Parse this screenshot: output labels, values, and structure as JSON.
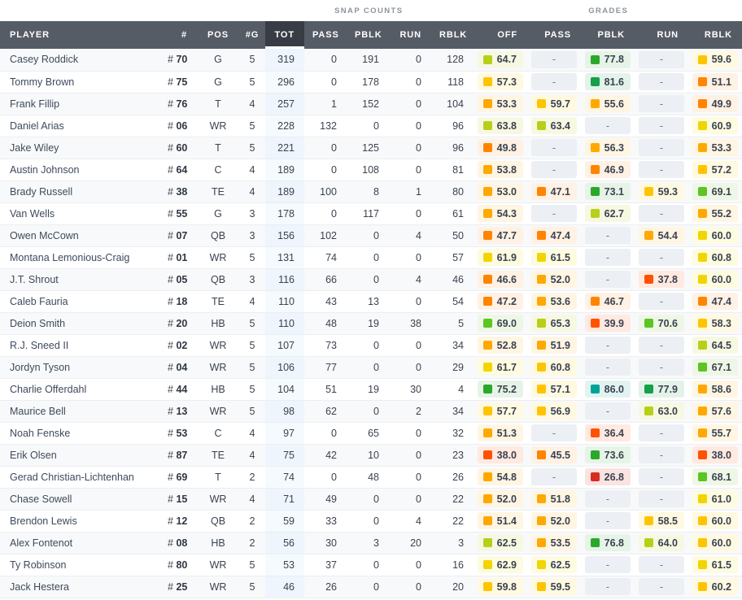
{
  "table": {
    "groups": [
      {
        "label": "",
        "span": 4,
        "kind": "gap"
      },
      {
        "label": "SNAP COUNTS",
        "span": 5,
        "kind": "snap"
      },
      {
        "label": "GRADES",
        "span": 5,
        "kind": "grades"
      }
    ],
    "columns": [
      {
        "key": "player",
        "label": "PLAYER",
        "align": "left"
      },
      {
        "key": "jersey",
        "label": "#",
        "align": "right"
      },
      {
        "key": "pos",
        "label": "POS",
        "align": "center"
      },
      {
        "key": "games",
        "label": "#G",
        "align": "center"
      },
      {
        "key": "snap_tot",
        "label": "TOT",
        "align": "right",
        "sorted": true
      },
      {
        "key": "snap_pass",
        "label": "PASS",
        "align": "right"
      },
      {
        "key": "snap_pblk",
        "label": "PBLK",
        "align": "right"
      },
      {
        "key": "snap_run",
        "label": "RUN",
        "align": "right"
      },
      {
        "key": "snap_rblk",
        "label": "RBLK",
        "align": "right"
      },
      {
        "key": "grade_off",
        "label": "OFF",
        "align": "right"
      },
      {
        "key": "grade_pass",
        "label": "PASS",
        "align": "right"
      },
      {
        "key": "grade_pblk",
        "label": "PBLK",
        "align": "right"
      },
      {
        "key": "grade_run",
        "label": "RUN",
        "align": "right"
      },
      {
        "key": "grade_rblk",
        "label": "RBLK",
        "align": "right"
      }
    ],
    "empty_value": "-",
    "grade_colors": {
      "teal": "#00a398",
      "dark_green": "#15a049",
      "green": "#2aa82a",
      "light_green": "#5cc423",
      "yellow_green": "#b8cf1a",
      "yellow": "#f2d500",
      "gold": "#ffc400",
      "amber": "#ffa800",
      "orange": "#ff8400",
      "deep_orange": "#ff5100",
      "red": "#d92b20"
    },
    "chip_backgrounds": {
      "teal": "#e2f4f2",
      "dark_green": "#e4f3e9",
      "green": "#e6f4e7",
      "light_green": "#eef7e5",
      "yellow_green": "#f6f8e2",
      "yellow": "#fdfbe0",
      "gold": "#fff9e2",
      "amber": "#fff5e3",
      "orange": "#fff1e3",
      "deep_orange": "#ffe9e0",
      "red": "#fae3e1"
    },
    "rows": [
      {
        "player": "Casey Roddick",
        "jersey": "70",
        "pos": "G",
        "games": "5",
        "snap_tot": "319",
        "snap_pass": "0",
        "snap_pblk": "191",
        "snap_run": "0",
        "snap_rblk": "128",
        "grade_off": {
          "v": "64.7",
          "c": "yellow_green"
        },
        "grade_pass": {
          "v": "-"
        },
        "grade_pblk": {
          "v": "77.8",
          "c": "green"
        },
        "grade_run": {
          "v": "-"
        },
        "grade_rblk": {
          "v": "59.6",
          "c": "gold"
        }
      },
      {
        "player": "Tommy Brown",
        "jersey": "75",
        "pos": "G",
        "games": "5",
        "snap_tot": "296",
        "snap_pass": "0",
        "snap_pblk": "178",
        "snap_run": "0",
        "snap_rblk": "118",
        "grade_off": {
          "v": "57.3",
          "c": "gold"
        },
        "grade_pass": {
          "v": "-"
        },
        "grade_pblk": {
          "v": "81.6",
          "c": "dark_green"
        },
        "grade_run": {
          "v": "-"
        },
        "grade_rblk": {
          "v": "51.1",
          "c": "orange"
        }
      },
      {
        "player": "Frank Fillip",
        "jersey": "76",
        "pos": "T",
        "games": "4",
        "snap_tot": "257",
        "snap_pass": "1",
        "snap_pblk": "152",
        "snap_run": "0",
        "snap_rblk": "104",
        "grade_off": {
          "v": "53.3",
          "c": "amber"
        },
        "grade_pass": {
          "v": "59.7",
          "c": "gold"
        },
        "grade_pblk": {
          "v": "55.6",
          "c": "amber"
        },
        "grade_run": {
          "v": "-"
        },
        "grade_rblk": {
          "v": "49.9",
          "c": "orange"
        }
      },
      {
        "player": "Daniel Arias",
        "jersey": "06",
        "pos": "WR",
        "games": "5",
        "snap_tot": "228",
        "snap_pass": "132",
        "snap_pblk": "0",
        "snap_run": "0",
        "snap_rblk": "96",
        "grade_off": {
          "v": "63.8",
          "c": "yellow_green"
        },
        "grade_pass": {
          "v": "63.4",
          "c": "yellow_green"
        },
        "grade_pblk": {
          "v": "-"
        },
        "grade_run": {
          "v": "-"
        },
        "grade_rblk": {
          "v": "60.9",
          "c": "yellow"
        }
      },
      {
        "player": "Jake Wiley",
        "jersey": "60",
        "pos": "T",
        "games": "5",
        "snap_tot": "221",
        "snap_pass": "0",
        "snap_pblk": "125",
        "snap_run": "0",
        "snap_rblk": "96",
        "grade_off": {
          "v": "49.8",
          "c": "orange"
        },
        "grade_pass": {
          "v": "-"
        },
        "grade_pblk": {
          "v": "56.3",
          "c": "amber"
        },
        "grade_run": {
          "v": "-"
        },
        "grade_rblk": {
          "v": "53.3",
          "c": "amber"
        }
      },
      {
        "player": "Austin Johnson",
        "jersey": "64",
        "pos": "C",
        "games": "4",
        "snap_tot": "189",
        "snap_pass": "0",
        "snap_pblk": "108",
        "snap_run": "0",
        "snap_rblk": "81",
        "grade_off": {
          "v": "53.8",
          "c": "amber"
        },
        "grade_pass": {
          "v": "-"
        },
        "grade_pblk": {
          "v": "46.9",
          "c": "orange"
        },
        "grade_run": {
          "v": "-"
        },
        "grade_rblk": {
          "v": "57.2",
          "c": "gold"
        }
      },
      {
        "player": "Brady Russell",
        "jersey": "38",
        "pos": "TE",
        "games": "4",
        "snap_tot": "189",
        "snap_pass": "100",
        "snap_pblk": "8",
        "snap_run": "1",
        "snap_rblk": "80",
        "grade_off": {
          "v": "53.0",
          "c": "amber"
        },
        "grade_pass": {
          "v": "47.1",
          "c": "orange"
        },
        "grade_pblk": {
          "v": "73.1",
          "c": "green"
        },
        "grade_run": {
          "v": "59.3",
          "c": "gold"
        },
        "grade_rblk": {
          "v": "69.1",
          "c": "light_green"
        }
      },
      {
        "player": "Van Wells",
        "jersey": "55",
        "pos": "G",
        "games": "3",
        "snap_tot": "178",
        "snap_pass": "0",
        "snap_pblk": "117",
        "snap_run": "0",
        "snap_rblk": "61",
        "grade_off": {
          "v": "54.3",
          "c": "amber"
        },
        "grade_pass": {
          "v": "-"
        },
        "grade_pblk": {
          "v": "62.7",
          "c": "yellow_green"
        },
        "grade_run": {
          "v": "-"
        },
        "grade_rblk": {
          "v": "55.2",
          "c": "amber"
        }
      },
      {
        "player": "Owen McCown",
        "jersey": "07",
        "pos": "QB",
        "games": "3",
        "snap_tot": "156",
        "snap_pass": "102",
        "snap_pblk": "0",
        "snap_run": "4",
        "snap_rblk": "50",
        "grade_off": {
          "v": "47.7",
          "c": "orange"
        },
        "grade_pass": {
          "v": "47.4",
          "c": "orange"
        },
        "grade_pblk": {
          "v": "-"
        },
        "grade_run": {
          "v": "54.4",
          "c": "amber"
        },
        "grade_rblk": {
          "v": "60.0",
          "c": "yellow"
        }
      },
      {
        "player": "Montana Lemonious-Craig",
        "jersey": "01",
        "pos": "WR",
        "games": "5",
        "snap_tot": "131",
        "snap_pass": "74",
        "snap_pblk": "0",
        "snap_run": "0",
        "snap_rblk": "57",
        "grade_off": {
          "v": "61.9",
          "c": "yellow"
        },
        "grade_pass": {
          "v": "61.5",
          "c": "yellow"
        },
        "grade_pblk": {
          "v": "-"
        },
        "grade_run": {
          "v": "-"
        },
        "grade_rblk": {
          "v": "60.8",
          "c": "yellow"
        }
      },
      {
        "player": "J.T. Shrout",
        "jersey": "05",
        "pos": "QB",
        "games": "3",
        "snap_tot": "116",
        "snap_pass": "66",
        "snap_pblk": "0",
        "snap_run": "4",
        "snap_rblk": "46",
        "grade_off": {
          "v": "46.6",
          "c": "orange"
        },
        "grade_pass": {
          "v": "52.0",
          "c": "amber"
        },
        "grade_pblk": {
          "v": "-"
        },
        "grade_run": {
          "v": "37.8",
          "c": "deep_orange"
        },
        "grade_rblk": {
          "v": "60.0",
          "c": "yellow"
        }
      },
      {
        "player": "Caleb Fauria",
        "jersey": "18",
        "pos": "TE",
        "games": "4",
        "snap_tot": "110",
        "snap_pass": "43",
        "snap_pblk": "13",
        "snap_run": "0",
        "snap_rblk": "54",
        "grade_off": {
          "v": "47.2",
          "c": "orange"
        },
        "grade_pass": {
          "v": "53.6",
          "c": "amber"
        },
        "grade_pblk": {
          "v": "46.7",
          "c": "orange"
        },
        "grade_run": {
          "v": "-"
        },
        "grade_rblk": {
          "v": "47.4",
          "c": "orange"
        }
      },
      {
        "player": "Deion Smith",
        "jersey": "20",
        "pos": "HB",
        "games": "5",
        "snap_tot": "110",
        "snap_pass": "48",
        "snap_pblk": "19",
        "snap_run": "38",
        "snap_rblk": "5",
        "grade_off": {
          "v": "69.0",
          "c": "light_green"
        },
        "grade_pass": {
          "v": "65.3",
          "c": "yellow_green"
        },
        "grade_pblk": {
          "v": "39.9",
          "c": "deep_orange"
        },
        "grade_run": {
          "v": "70.6",
          "c": "light_green"
        },
        "grade_rblk": {
          "v": "58.3",
          "c": "gold"
        }
      },
      {
        "player": "R.J. Sneed II",
        "jersey": "02",
        "pos": "WR",
        "games": "5",
        "snap_tot": "107",
        "snap_pass": "73",
        "snap_pblk": "0",
        "snap_run": "0",
        "snap_rblk": "34",
        "grade_off": {
          "v": "52.8",
          "c": "amber"
        },
        "grade_pass": {
          "v": "51.9",
          "c": "amber"
        },
        "grade_pblk": {
          "v": "-"
        },
        "grade_run": {
          "v": "-"
        },
        "grade_rblk": {
          "v": "64.5",
          "c": "yellow_green"
        }
      },
      {
        "player": "Jordyn Tyson",
        "jersey": "04",
        "pos": "WR",
        "games": "5",
        "snap_tot": "106",
        "snap_pass": "77",
        "snap_pblk": "0",
        "snap_run": "0",
        "snap_rblk": "29",
        "grade_off": {
          "v": "61.7",
          "c": "yellow"
        },
        "grade_pass": {
          "v": "60.8",
          "c": "gold"
        },
        "grade_pblk": {
          "v": "-"
        },
        "grade_run": {
          "v": "-"
        },
        "grade_rblk": {
          "v": "67.1",
          "c": "light_green"
        }
      },
      {
        "player": "Charlie Offerdahl",
        "jersey": "44",
        "pos": "HB",
        "games": "5",
        "snap_tot": "104",
        "snap_pass": "51",
        "snap_pblk": "19",
        "snap_run": "30",
        "snap_rblk": "4",
        "grade_off": {
          "v": "75.2",
          "c": "green"
        },
        "grade_pass": {
          "v": "57.1",
          "c": "gold"
        },
        "grade_pblk": {
          "v": "86.0",
          "c": "teal"
        },
        "grade_run": {
          "v": "77.9",
          "c": "dark_green"
        },
        "grade_rblk": {
          "v": "58.6",
          "c": "amber"
        }
      },
      {
        "player": "Maurice Bell",
        "jersey": "13",
        "pos": "WR",
        "games": "5",
        "snap_tot": "98",
        "snap_pass": "62",
        "snap_pblk": "0",
        "snap_run": "2",
        "snap_rblk": "34",
        "grade_off": {
          "v": "57.7",
          "c": "gold"
        },
        "grade_pass": {
          "v": "56.9",
          "c": "gold"
        },
        "grade_pblk": {
          "v": "-"
        },
        "grade_run": {
          "v": "63.0",
          "c": "yellow_green"
        },
        "grade_rblk": {
          "v": "57.6",
          "c": "amber"
        }
      },
      {
        "player": "Noah Fenske",
        "jersey": "53",
        "pos": "C",
        "games": "4",
        "snap_tot": "97",
        "snap_pass": "0",
        "snap_pblk": "65",
        "snap_run": "0",
        "snap_rblk": "32",
        "grade_off": {
          "v": "51.3",
          "c": "amber"
        },
        "grade_pass": {
          "v": "-"
        },
        "grade_pblk": {
          "v": "36.4",
          "c": "deep_orange"
        },
        "grade_run": {
          "v": "-"
        },
        "grade_rblk": {
          "v": "55.7",
          "c": "amber"
        }
      },
      {
        "player": "Erik Olsen",
        "jersey": "87",
        "pos": "TE",
        "games": "4",
        "snap_tot": "75",
        "snap_pass": "42",
        "snap_pblk": "10",
        "snap_run": "0",
        "snap_rblk": "23",
        "grade_off": {
          "v": "38.0",
          "c": "deep_orange"
        },
        "grade_pass": {
          "v": "45.5",
          "c": "orange"
        },
        "grade_pblk": {
          "v": "73.6",
          "c": "green"
        },
        "grade_run": {
          "v": "-"
        },
        "grade_rblk": {
          "v": "38.0",
          "c": "deep_orange"
        }
      },
      {
        "player": "Gerad Christian-Lichtenhan",
        "jersey": "69",
        "pos": "T",
        "games": "2",
        "snap_tot": "74",
        "snap_pass": "0",
        "snap_pblk": "48",
        "snap_run": "0",
        "snap_rblk": "26",
        "grade_off": {
          "v": "54.8",
          "c": "amber"
        },
        "grade_pass": {
          "v": "-"
        },
        "grade_pblk": {
          "v": "26.8",
          "c": "red"
        },
        "grade_run": {
          "v": "-"
        },
        "grade_rblk": {
          "v": "68.1",
          "c": "light_green"
        }
      },
      {
        "player": "Chase Sowell",
        "jersey": "15",
        "pos": "WR",
        "games": "4",
        "snap_tot": "71",
        "snap_pass": "49",
        "snap_pblk": "0",
        "snap_run": "0",
        "snap_rblk": "22",
        "grade_off": {
          "v": "52.0",
          "c": "amber"
        },
        "grade_pass": {
          "v": "51.8",
          "c": "amber"
        },
        "grade_pblk": {
          "v": "-"
        },
        "grade_run": {
          "v": "-"
        },
        "grade_rblk": {
          "v": "61.0",
          "c": "yellow"
        }
      },
      {
        "player": "Brendon Lewis",
        "jersey": "12",
        "pos": "QB",
        "games": "2",
        "snap_tot": "59",
        "snap_pass": "33",
        "snap_pblk": "0",
        "snap_run": "4",
        "snap_rblk": "22",
        "grade_off": {
          "v": "51.4",
          "c": "amber"
        },
        "grade_pass": {
          "v": "52.0",
          "c": "amber"
        },
        "grade_pblk": {
          "v": "-"
        },
        "grade_run": {
          "v": "58.5",
          "c": "gold"
        },
        "grade_rblk": {
          "v": "60.0",
          "c": "gold"
        }
      },
      {
        "player": "Alex Fontenot",
        "jersey": "08",
        "pos": "HB",
        "games": "2",
        "snap_tot": "56",
        "snap_pass": "30",
        "snap_pblk": "3",
        "snap_run": "20",
        "snap_rblk": "3",
        "grade_off": {
          "v": "62.5",
          "c": "yellow_green"
        },
        "grade_pass": {
          "v": "53.5",
          "c": "amber"
        },
        "grade_pblk": {
          "v": "76.8",
          "c": "green"
        },
        "grade_run": {
          "v": "64.0",
          "c": "yellow_green"
        },
        "grade_rblk": {
          "v": "60.0",
          "c": "gold"
        }
      },
      {
        "player": "Ty Robinson",
        "jersey": "80",
        "pos": "WR",
        "games": "5",
        "snap_tot": "53",
        "snap_pass": "37",
        "snap_pblk": "0",
        "snap_run": "0",
        "snap_rblk": "16",
        "grade_off": {
          "v": "62.9",
          "c": "yellow"
        },
        "grade_pass": {
          "v": "62.5",
          "c": "yellow"
        },
        "grade_pblk": {
          "v": "-"
        },
        "grade_run": {
          "v": "-"
        },
        "grade_rblk": {
          "v": "61.5",
          "c": "yellow"
        }
      },
      {
        "player": "Jack Hestera",
        "jersey": "25",
        "pos": "WR",
        "games": "5",
        "snap_tot": "46",
        "snap_pass": "26",
        "snap_pblk": "0",
        "snap_run": "0",
        "snap_rblk": "20",
        "grade_off": {
          "v": "59.8",
          "c": "gold"
        },
        "grade_pass": {
          "v": "59.5",
          "c": "gold"
        },
        "grade_pblk": {
          "v": "-"
        },
        "grade_run": {
          "v": "-"
        },
        "grade_rblk": {
          "v": "60.2",
          "c": "gold"
        }
      }
    ]
  }
}
